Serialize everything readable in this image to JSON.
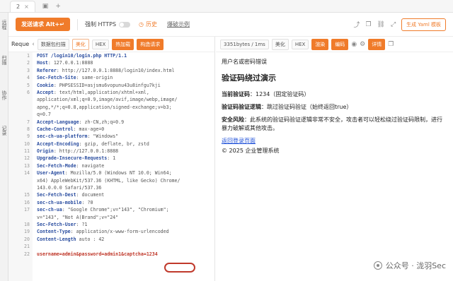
{
  "tabbar": {
    "tab_number": "2",
    "tab_close": "×",
    "new_tab": "+"
  },
  "rail": {
    "items": [
      "远程",
      "扫描",
      "协作",
      "记录"
    ]
  },
  "toolbar": {
    "send_label": "发送请求 Alt+↵",
    "force_https_label": "强制 HTTPS",
    "history_label": "历史",
    "example_label": "爆破示例",
    "gen_yaml_label": "生成 Yaml 模板"
  },
  "request": {
    "label": "Reque",
    "buttons": [
      "数据包扫描",
      "美化",
      "HEX",
      "热加载",
      "构造请求"
    ],
    "lines": [
      {
        "n": "1",
        "k": "POST /login10/login.php HTTP/1.1",
        "v": ""
      },
      {
        "n": "2",
        "k": "Host",
        "v": ": 127.0.0.1:8888"
      },
      {
        "n": "3",
        "k": "Referer",
        "v": ": http://127.0.0.1:8888/login10/index.html"
      },
      {
        "n": "4",
        "k": "Sec-Fetch-Site",
        "v": ": same-origin"
      },
      {
        "n": "5",
        "k": "Cookie",
        "v": ": PHPSESSID=asjsmu6vopunu43u8infgu7kji"
      },
      {
        "n": "6",
        "k": "Accept",
        "v": ": text/html,application/xhtml+xml,"
      },
      {
        "n": "",
        "k": "",
        "v": "application/xml;q=0.9,image/avif,image/webp,image/"
      },
      {
        "n": "",
        "k": "",
        "v": "apng,*/*;q=0.8,application/signed-exchange;v=b3;"
      },
      {
        "n": "",
        "k": "",
        "v": "q=0.7"
      },
      {
        "n": "7",
        "k": "Accept-Language",
        "v": ": zh-CN,zh;q=0.9"
      },
      {
        "n": "8",
        "k": "Cache-Control",
        "v": ": max-age=0"
      },
      {
        "n": "9",
        "k": "sec-ch-ua-platform",
        "v": ": \"Windows\""
      },
      {
        "n": "10",
        "k": "Accept-Encoding",
        "v": ": gzip, deflate, br, zstd"
      },
      {
        "n": "11",
        "k": "Origin",
        "v": ": http://127.0.0.1:8888"
      },
      {
        "n": "12",
        "k": "Upgrade-Insecure-Requests",
        "v": ": 1"
      },
      {
        "n": "13",
        "k": "Sec-Fetch-Mode",
        "v": ": navigate"
      },
      {
        "n": "14",
        "k": "User-Agent",
        "v": ": Mozilla/5.0 (Windows NT 10.0; Win64;"
      },
      {
        "n": "",
        "k": "",
        "v": "x64) AppleWebKit/537.36 (KHTML, like Gecko) Chrome/"
      },
      {
        "n": "",
        "k": "",
        "v": "143.0.0.0 Safari/537.36"
      },
      {
        "n": "15",
        "k": "Sec-Fetch-Dest",
        "v": ": document"
      },
      {
        "n": "16",
        "k": "sec-ch-ua-mobile",
        "v": ": ?0"
      },
      {
        "n": "17",
        "k": "sec-ch-ua",
        "v": ": \"Google Chrome\";v=\"143\", \"Chromium\";"
      },
      {
        "n": "",
        "k": "",
        "v": "v=\"143\", \"Not A(Brand\";v=\"24\""
      },
      {
        "n": "18",
        "k": "Sec-Fetch-User",
        "v": ": ?1"
      },
      {
        "n": "19",
        "k": "Content-Type",
        "v": ": application/x-www-form-urlencoded"
      },
      {
        "n": "20",
        "k": "Content-Length",
        "v": " auto : 42"
      },
      {
        "n": "21",
        "k": "",
        "v": ""
      },
      {
        "n": "22",
        "k": "username=admin&password=admin1&captcha=1234",
        "v": ""
      }
    ]
  },
  "response": {
    "size_label": "3351bytes / 1ms",
    "buttons": [
      "美化",
      "HEX",
      "渲染",
      "编码",
      "详情"
    ],
    "error_text": "用户名或密码错误",
    "title": "验证码绕过演示",
    "current_label": "当前验证码",
    "current_value": "：1234（固定验证码）",
    "logic_label": "验证码验证逻辑",
    "logic_value": "：跳过验证码验证（始终返回true）",
    "risk_label": "安全风险",
    "risk_value": "：此系统的验证码验证逻辑非常不安全，攻击者可以轻松绕过验证码限制，进行暴力破解或其他攻击。",
    "back_link": "返回登录页面",
    "copyright": "© 2025 企业管理系统"
  },
  "watermark": {
    "text": "公众号 · 泷羽Sec"
  }
}
